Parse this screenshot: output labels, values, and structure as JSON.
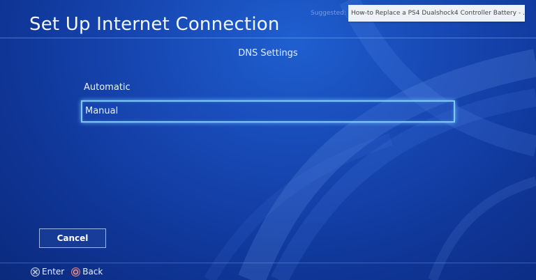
{
  "header": {
    "title": "Set Up Internet Connection"
  },
  "suggestion": {
    "prefix": "Suggested:",
    "text": "How-to Replace a PS4 Dualshock4 Controller Battery - ..."
  },
  "dialog": {
    "section_title": "DNS Settings",
    "options": [
      {
        "label": "Automatic",
        "selected": false
      },
      {
        "label": "Manual",
        "selected": true
      }
    ],
    "cancel_label": "Cancel"
  },
  "footer": {
    "enter_label": "Enter",
    "back_label": "Back",
    "enter_icon": "cross-button-icon",
    "back_icon": "circle-button-icon"
  },
  "colors": {
    "background": "#1748b4",
    "focus_border": "#7fc8ff"
  }
}
